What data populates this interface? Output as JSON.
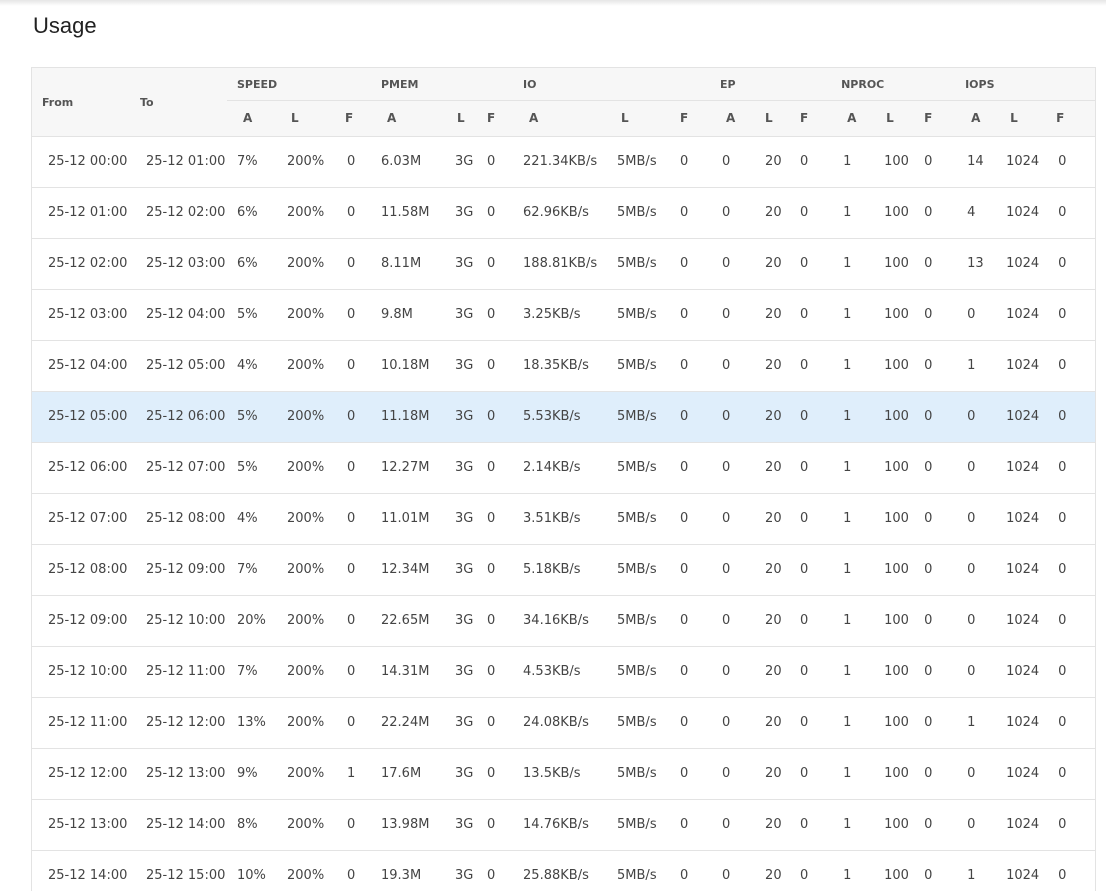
{
  "page": {
    "title": "Usage"
  },
  "table": {
    "fixed_headers": [
      "From",
      "To"
    ],
    "groups": [
      "SPEED",
      "PMEM",
      "IO",
      "EP",
      "NPROC",
      "IOPS"
    ],
    "sub_headers": [
      "A",
      "L",
      "F"
    ],
    "highlight_row": 5,
    "rows": [
      [
        "25-12 00:00",
        "25-12 01:00",
        "7%",
        "200%",
        "0",
        "6.03M",
        "3G",
        "0",
        "221.34KB/s",
        "5MB/s",
        "0",
        "0",
        "20",
        "0",
        "1",
        "100",
        "0",
        "14",
        "1024",
        "0"
      ],
      [
        "25-12 01:00",
        "25-12 02:00",
        "6%",
        "200%",
        "0",
        "11.58M",
        "3G",
        "0",
        "62.96KB/s",
        "5MB/s",
        "0",
        "0",
        "20",
        "0",
        "1",
        "100",
        "0",
        "4",
        "1024",
        "0"
      ],
      [
        "25-12 02:00",
        "25-12 03:00",
        "6%",
        "200%",
        "0",
        "8.11M",
        "3G",
        "0",
        "188.81KB/s",
        "5MB/s",
        "0",
        "0",
        "20",
        "0",
        "1",
        "100",
        "0",
        "13",
        "1024",
        "0"
      ],
      [
        "25-12 03:00",
        "25-12 04:00",
        "5%",
        "200%",
        "0",
        "9.8M",
        "3G",
        "0",
        "3.25KB/s",
        "5MB/s",
        "0",
        "0",
        "20",
        "0",
        "1",
        "100",
        "0",
        "0",
        "1024",
        "0"
      ],
      [
        "25-12 04:00",
        "25-12 05:00",
        "4%",
        "200%",
        "0",
        "10.18M",
        "3G",
        "0",
        "18.35KB/s",
        "5MB/s",
        "0",
        "0",
        "20",
        "0",
        "1",
        "100",
        "0",
        "1",
        "1024",
        "0"
      ],
      [
        "25-12 05:00",
        "25-12 06:00",
        "5%",
        "200%",
        "0",
        "11.18M",
        "3G",
        "0",
        "5.53KB/s",
        "5MB/s",
        "0",
        "0",
        "20",
        "0",
        "1",
        "100",
        "0",
        "0",
        "1024",
        "0"
      ],
      [
        "25-12 06:00",
        "25-12 07:00",
        "5%",
        "200%",
        "0",
        "12.27M",
        "3G",
        "0",
        "2.14KB/s",
        "5MB/s",
        "0",
        "0",
        "20",
        "0",
        "1",
        "100",
        "0",
        "0",
        "1024",
        "0"
      ],
      [
        "25-12 07:00",
        "25-12 08:00",
        "4%",
        "200%",
        "0",
        "11.01M",
        "3G",
        "0",
        "3.51KB/s",
        "5MB/s",
        "0",
        "0",
        "20",
        "0",
        "1",
        "100",
        "0",
        "0",
        "1024",
        "0"
      ],
      [
        "25-12 08:00",
        "25-12 09:00",
        "7%",
        "200%",
        "0",
        "12.34M",
        "3G",
        "0",
        "5.18KB/s",
        "5MB/s",
        "0",
        "0",
        "20",
        "0",
        "1",
        "100",
        "0",
        "0",
        "1024",
        "0"
      ],
      [
        "25-12 09:00",
        "25-12 10:00",
        "20%",
        "200%",
        "0",
        "22.65M",
        "3G",
        "0",
        "34.16KB/s",
        "5MB/s",
        "0",
        "0",
        "20",
        "0",
        "1",
        "100",
        "0",
        "0",
        "1024",
        "0"
      ],
      [
        "25-12 10:00",
        "25-12 11:00",
        "7%",
        "200%",
        "0",
        "14.31M",
        "3G",
        "0",
        "4.53KB/s",
        "5MB/s",
        "0",
        "0",
        "20",
        "0",
        "1",
        "100",
        "0",
        "0",
        "1024",
        "0"
      ],
      [
        "25-12 11:00",
        "25-12 12:00",
        "13%",
        "200%",
        "0",
        "22.24M",
        "3G",
        "0",
        "24.08KB/s",
        "5MB/s",
        "0",
        "0",
        "20",
        "0",
        "1",
        "100",
        "0",
        "1",
        "1024",
        "0"
      ],
      [
        "25-12 12:00",
        "25-12 13:00",
        "9%",
        "200%",
        "1",
        "17.6M",
        "3G",
        "0",
        "13.5KB/s",
        "5MB/s",
        "0",
        "0",
        "20",
        "0",
        "1",
        "100",
        "0",
        "0",
        "1024",
        "0"
      ],
      [
        "25-12 13:00",
        "25-12 14:00",
        "8%",
        "200%",
        "0",
        "13.98M",
        "3G",
        "0",
        "14.76KB/s",
        "5MB/s",
        "0",
        "0",
        "20",
        "0",
        "1",
        "100",
        "0",
        "0",
        "1024",
        "0"
      ],
      [
        "25-12 14:00",
        "25-12 15:00",
        "10%",
        "200%",
        "0",
        "19.3M",
        "3G",
        "0",
        "25.88KB/s",
        "5MB/s",
        "0",
        "0",
        "20",
        "0",
        "1",
        "100",
        "0",
        "1",
        "1024",
        "0"
      ]
    ]
  }
}
